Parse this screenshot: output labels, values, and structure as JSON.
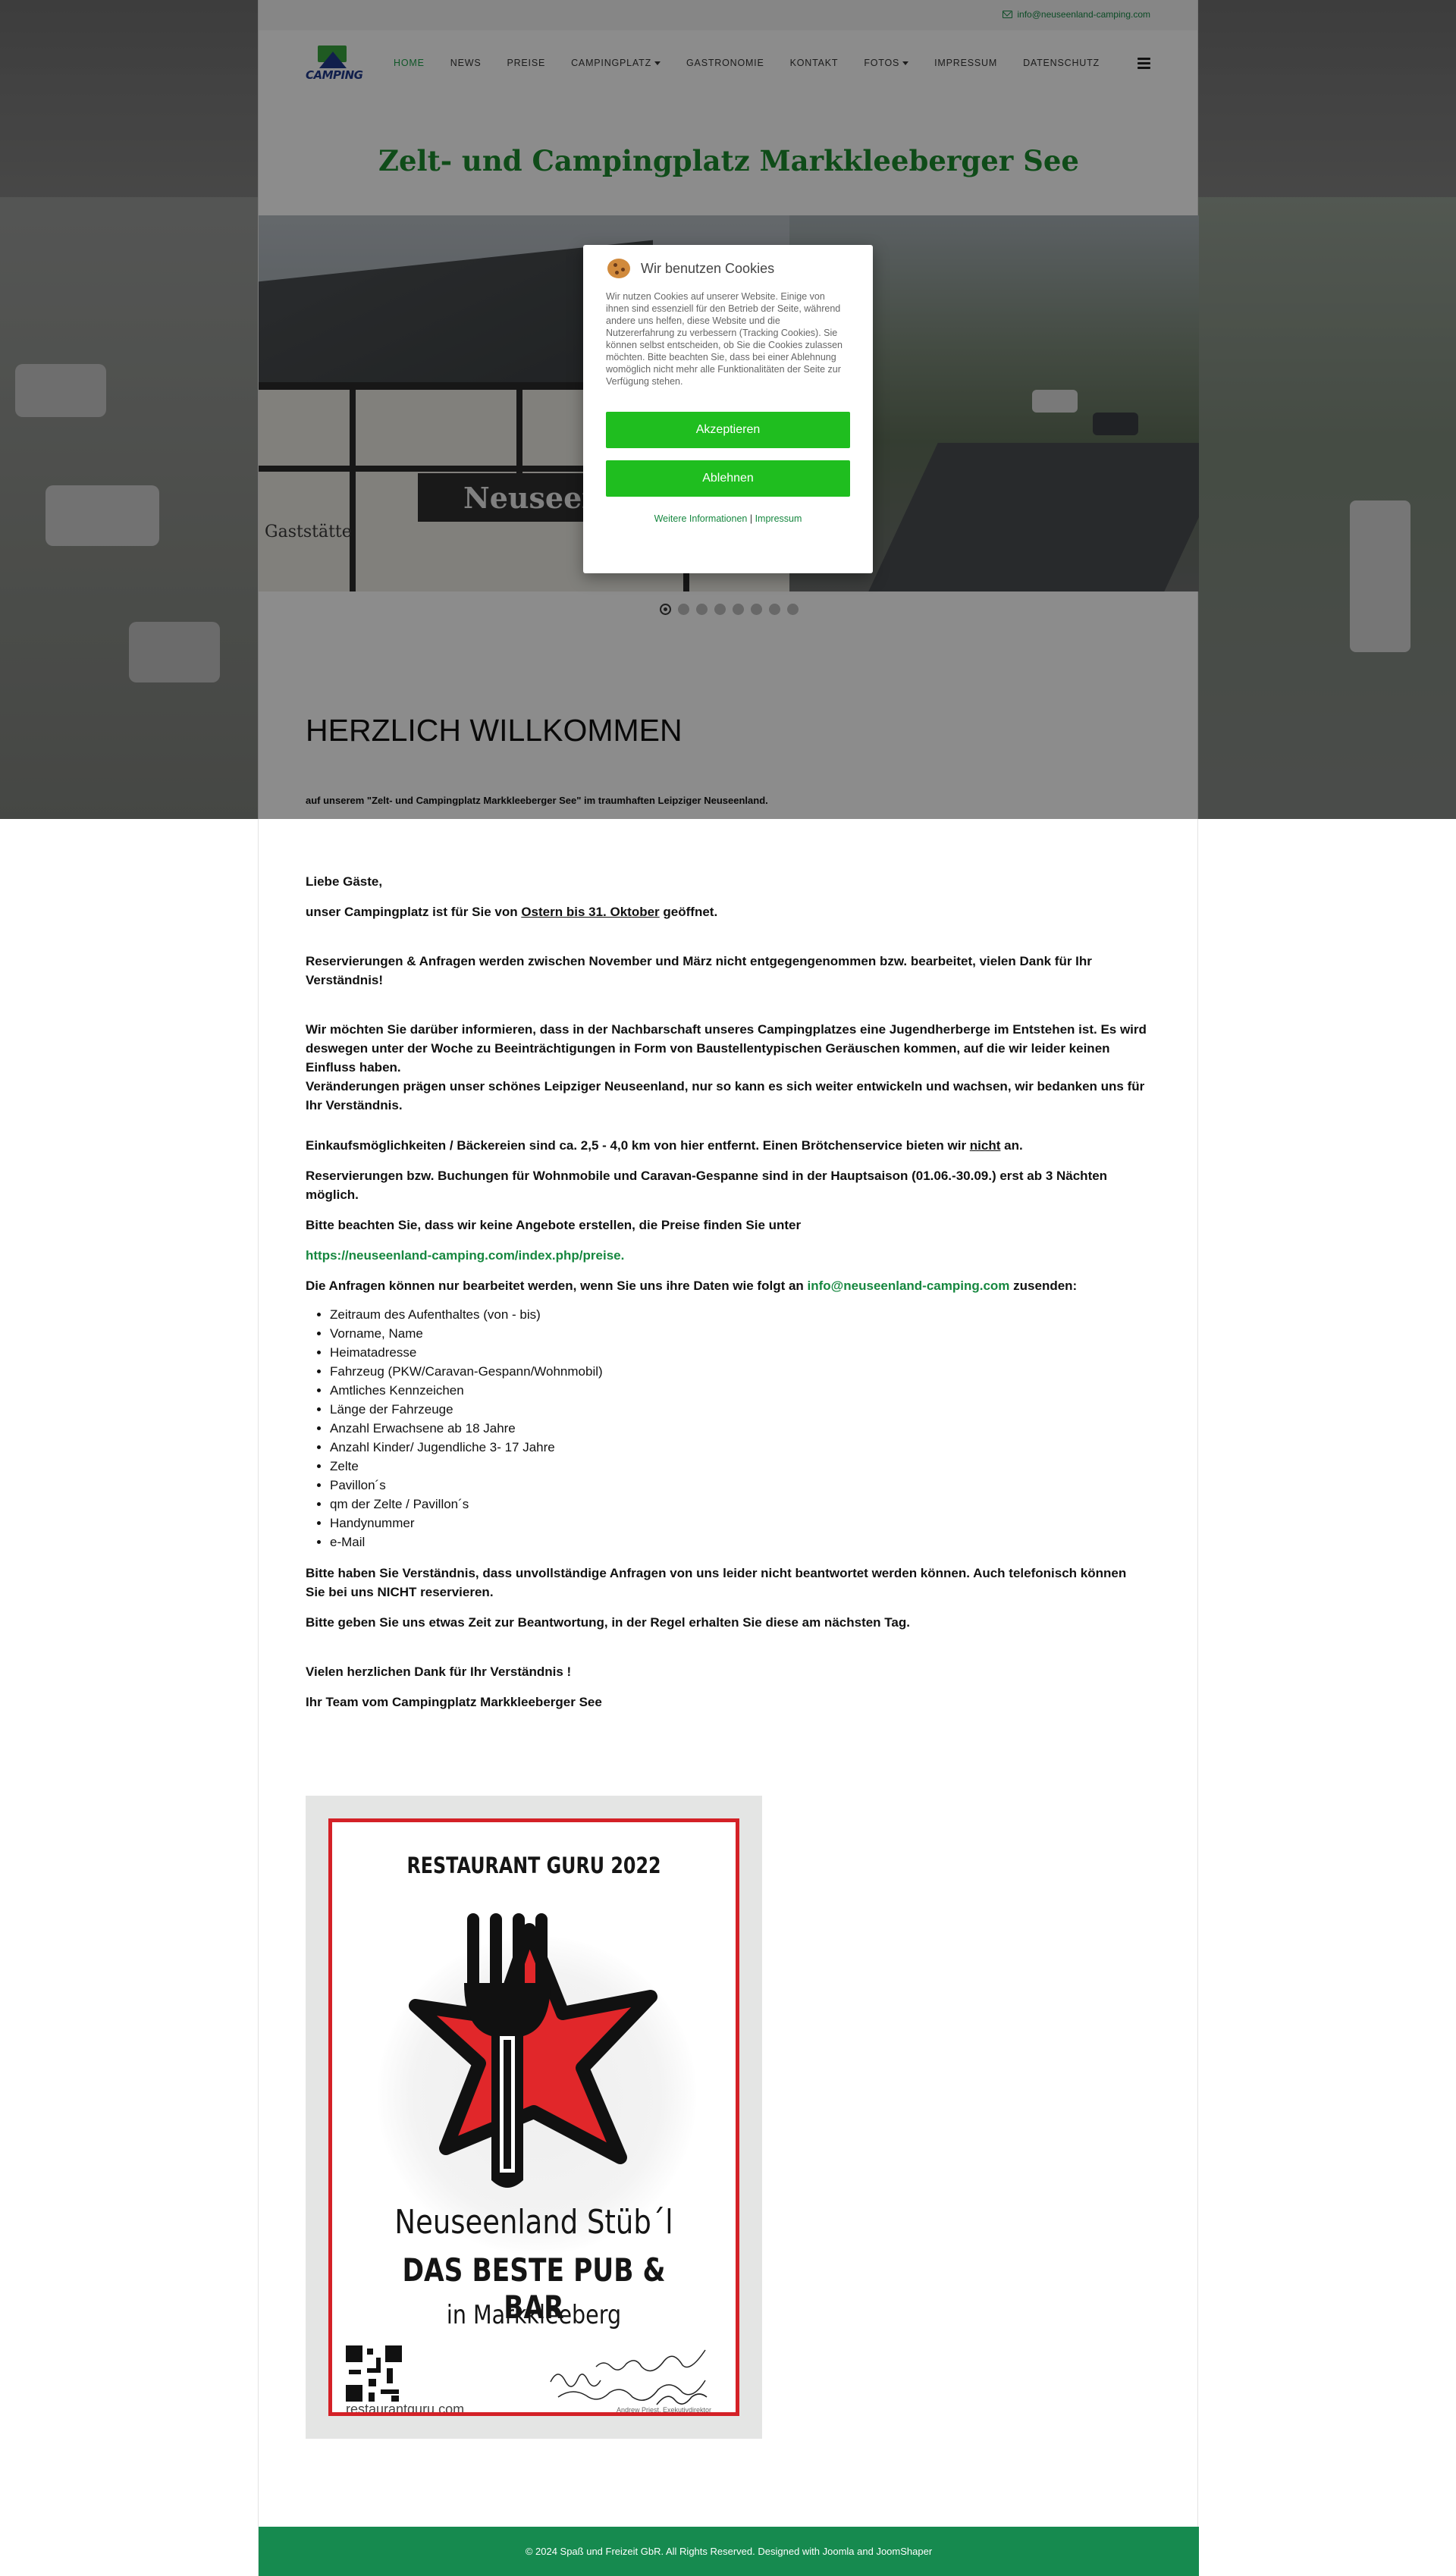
{
  "topbar": {
    "email": "info@neuseenland-camping.com"
  },
  "logo": {
    "text": "CAMPING"
  },
  "nav": {
    "items": [
      {
        "label": "HOME",
        "active": true,
        "dropdown": false
      },
      {
        "label": "NEWS",
        "active": false,
        "dropdown": false
      },
      {
        "label": "PREISE",
        "active": false,
        "dropdown": false
      },
      {
        "label": "CAMPINGPLATZ",
        "active": false,
        "dropdown": true
      },
      {
        "label": "GASTRONOMIE",
        "active": false,
        "dropdown": false
      },
      {
        "label": "KONTAKT",
        "active": false,
        "dropdown": false
      },
      {
        "label": "FOTOS",
        "active": false,
        "dropdown": true
      },
      {
        "label": "IMPRESSUM",
        "active": false,
        "dropdown": false
      },
      {
        "label": "DATENSCHUTZ",
        "active": false,
        "dropdown": false
      }
    ],
    "menu_icon": "hamburger-icon"
  },
  "hero": {
    "title": "Zelt- und Campingplatz Markkleeberger See",
    "sign_text": "Neuseen",
    "gast_text": "Gaststätte",
    "slide_count": 8,
    "active_slide": 1
  },
  "welcome": {
    "heading": "HERZLICH WILLKOMMEN",
    "subtitle": "auf unserem \"Zelt- und Campingplatz Markkleeberger See\" im traumhaften Leipziger Neuseenland."
  },
  "content": {
    "greeting": "Liebe Gäste,",
    "opening_pre": "unser Campingplatz ist für Sie von ",
    "opening_u": "Ostern bis 31. Oktober",
    "opening_post": " geöffnet.",
    "reservations_note": "Reservierungen & Anfragen werden zwischen November und März nicht entgegengenommen bzw. bearbeitet, vielen Dank für Ihr Verständnis!",
    "neighbour_note": "Wir möchten Sie darüber informieren, dass in der Nachbarschaft unseres Campingplatzes eine Jugendherberge im Entstehen ist. Es wird deswegen unter der Woche zu Beeinträchtigungen in Form von Baustellentypischen Geräuschen kommen, auf die wir leider keinen Einfluss haben.",
    "change_note": "Veränderungen prägen unser schönes Leipziger Neuseenland, nur so kann es sich weiter entwickeln und wachsen, wir bedanken uns für Ihr Verständnis.",
    "shopping_pre": "Einkaufsmöglichkeiten / Bäckereien sind ca. 2,5 - 4,0 km von hier entfernt. Einen Brötchenservice bieten wir ",
    "shopping_u": "nicht",
    "shopping_post": " an.",
    "booking_note": "Reservierungen bzw. Buchungen für Wohnmobile und Caravan-Gespanne sind in der Hauptsaison (01.06.-30.09.) erst ab 3 Nächten möglich.",
    "offers_note": "Bitte beachten Sie, dass wir keine Angebote erstellen, die Preise finden Sie unter",
    "prices_link": "https://neuseenland-camping.com/index.php/preise.",
    "request_pre": "Die Anfragen können nur bearbeitet werden, wenn Sie uns ihre Daten wie folgt an ",
    "request_email": "info@neuseenland-camping.com",
    "request_post": " zusenden:",
    "required_fields": [
      "Zeitraum des Aufenthaltes (von - bis)",
      "Vorname, Name",
      "Heimatadresse",
      "Fahrzeug (PKW/Caravan-Gespann/Wohnmobil)",
      "Amtliches Kennzeichen",
      "Länge der Fahrzeuge",
      "Anzahl Erwachsene ab 18 Jahre",
      "Anzahl Kinder/ Jugendliche 3- 17 Jahre",
      "Zelte",
      "Pavillon´s",
      "qm der Zelte / Pavillon´s",
      "Handynummer",
      "e-Mail"
    ],
    "incomplete_note": "Bitte haben Sie Verständnis, dass unvollständige Anfragen von uns leider nicht beantwortet werden können. Auch telefonisch können Sie bei uns NICHT reservieren.",
    "time_note": "Bitte geben Sie uns etwas Zeit zur Beantwortung, in der Regel erhalten Sie diese am nächsten Tag.",
    "thanks": "Vielen herzlichen Dank für Ihr Verständnis !",
    "signature": "Ihr Team vom Campingplatz Markkleeberger See"
  },
  "badge": {
    "title": "RESTAURANT GURU 2022",
    "name": "Neuseenland Stüb´l",
    "award": "DAS BESTE PUB & BAR",
    "city": "in Markkleeberg",
    "url": "restaurantguru.com",
    "signature_text": "Congrats to the Neuseenland Stüb´l team!",
    "signer": "Andrew Priest, Exekutivdirektor",
    "border_color": "#d42127",
    "star_color": "#e1272a"
  },
  "footer": {
    "text": "© 2024 Spaß und Freizeit GbR. All Rights Reserved. Designed with Joomla and JoomShaper"
  },
  "cookie": {
    "title": "Wir benutzen Cookies",
    "text": "Wir nutzen Cookies auf unserer Website. Einige von ihnen sind essenziell für den Betrieb der Seite, während andere uns helfen, diese Website und die Nutzererfahrung zu verbessern (Tracking Cookies). Sie können selbst entscheiden, ob Sie die Cookies zulassen möchten. Bitte beachten Sie, dass bei einer Ablehnung womöglich nicht mehr alle Funktionalitäten der Seite zur Verfügung stehen.",
    "accept": "Akzeptieren",
    "decline": "Ablehnen",
    "more_info": "Weitere Informationen",
    "separator": "|",
    "imprint": "Impressum",
    "button_color": "#1fbe1f",
    "icon": "cookie-icon"
  }
}
